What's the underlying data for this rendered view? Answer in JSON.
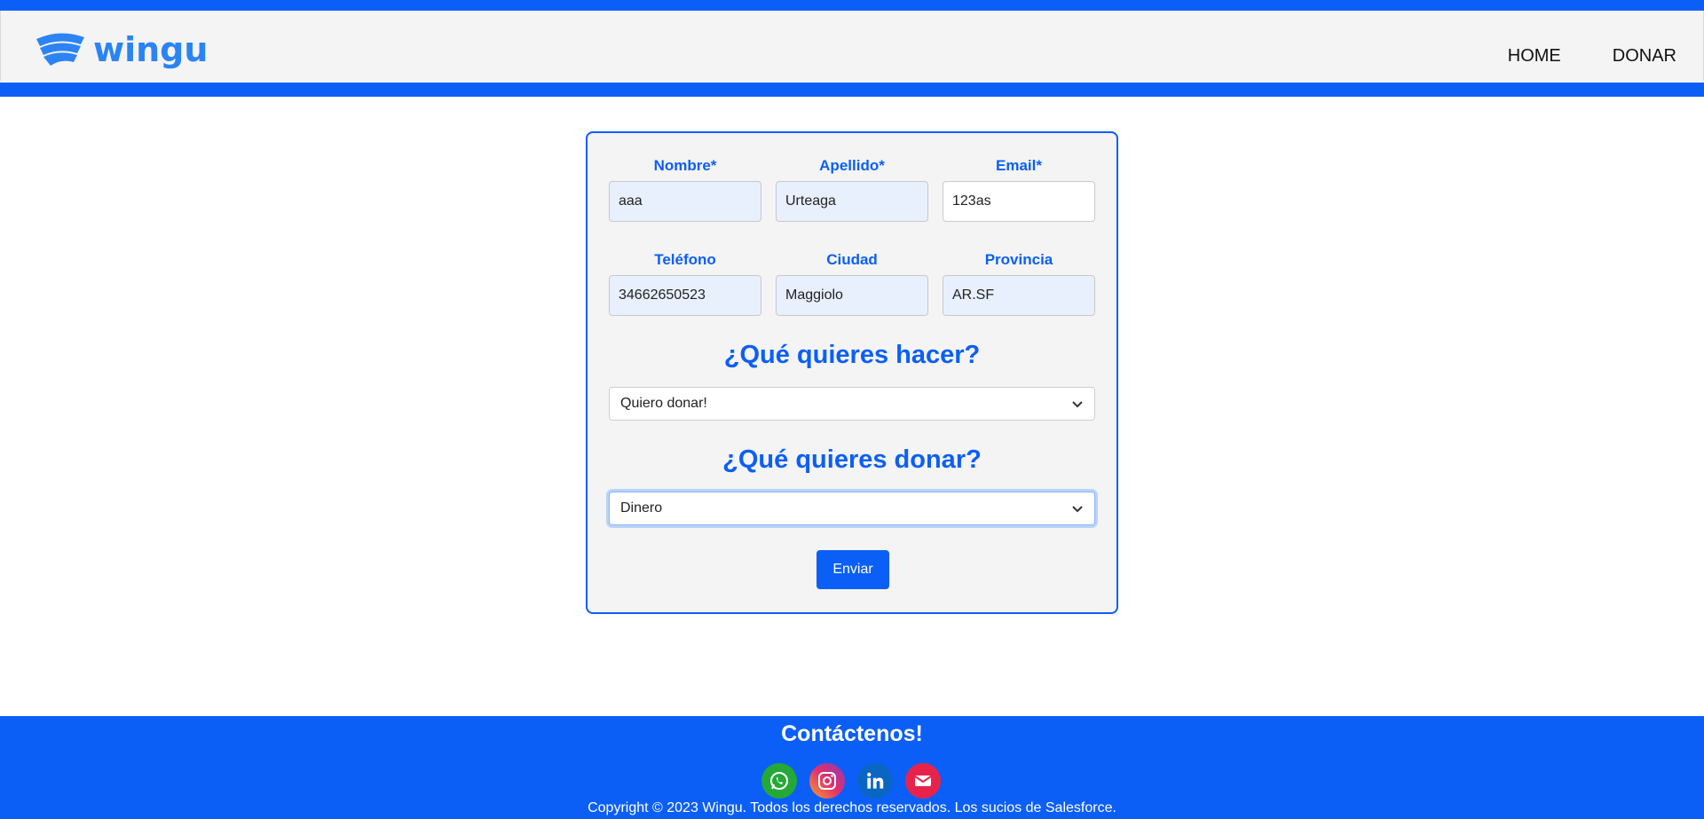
{
  "header": {
    "logo_text": "wingu",
    "nav": [
      "HOME",
      "DONAR"
    ]
  },
  "form": {
    "fields": [
      {
        "label": "Nombre*",
        "value": "aaa"
      },
      {
        "label": "Apellido*",
        "value": "Urteaga"
      },
      {
        "label": "Email*",
        "value": "123as"
      },
      {
        "label": "Teléfono",
        "value": "34662650523"
      },
      {
        "label": "Ciudad",
        "value": "Maggiolo"
      },
      {
        "label": "Provincia",
        "value": "AR.SF"
      }
    ],
    "question_action": "¿Qué quieres hacer?",
    "action_selected": "Quiero donar!",
    "question_donation": "¿Qué quieres donar?",
    "donation_selected": "Dinero",
    "submit_label": "Enviar"
  },
  "footer": {
    "title": "Contáctenos!",
    "socials": [
      "whatsapp-icon",
      "instagram-icon",
      "linkedin-icon",
      "email-icon"
    ],
    "copyright": "Copyright © 2023 Wingu. Todos los derechos reservados. Los sucios de Salesforce."
  },
  "colors": {
    "primary": "#0b5ff7",
    "logo": "#2c84f4",
    "autofill": "#e8f0fe"
  }
}
